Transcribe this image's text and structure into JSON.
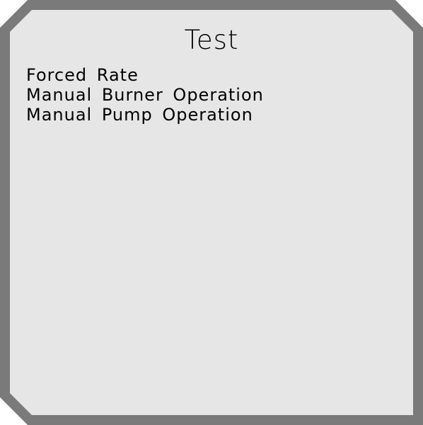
{
  "panel": {
    "title": "Test",
    "items": [
      {
        "label": "Forced Rate"
      },
      {
        "label": "Manual Burner Operation"
      },
      {
        "label": "Manual Pump Operation"
      }
    ]
  },
  "colors": {
    "border": "#7a7a7a",
    "panel_background": "#e6e6e6",
    "text": "#000000"
  }
}
